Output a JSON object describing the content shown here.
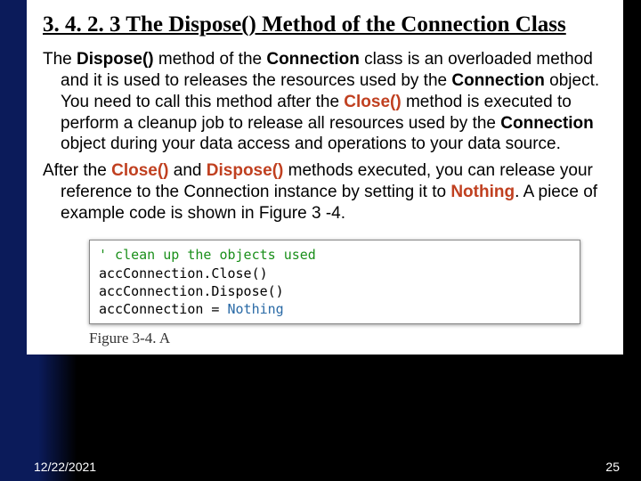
{
  "heading": "3. 4. 2. 3   The Dispose() Method of the Connection Class",
  "p1": {
    "t1": "The ",
    "b1": "Dispose()",
    "t2": " method of the ",
    "b2": "Connection",
    "t3": " class is an overloaded method and it is used to releases the resources used by the ",
    "b3": "Connection",
    "t4": " object. You need to call this method after the ",
    "r1": "Close()",
    "t5": " method is executed to perform a cleanup job to release all resources used by the ",
    "b4": "Connection",
    "t6": " object during your data access and operations to your data source."
  },
  "p2": {
    "t1": "After the ",
    "r1": "Close()",
    "t2": " and ",
    "r2": "Dispose()",
    "t3": " methods executed, you can release your reference to the Connection instance by setting it to ",
    "r3": "Nothing",
    "t4": ". A piece of example code is shown in Figure 3 -4."
  },
  "code": {
    "comment": "' clean up the objects used",
    "l1": "accConnection.Close()",
    "l2": "accConnection.Dispose()",
    "l3a": "accConnection = ",
    "l3k": "Nothing"
  },
  "caption": "Figure 3-4. A",
  "footer": {
    "date": "12/22/2021",
    "page": "25"
  }
}
